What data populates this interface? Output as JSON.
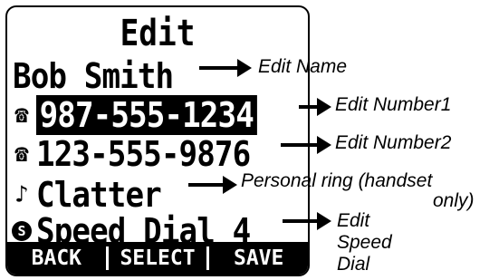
{
  "screen": {
    "title": "Edit",
    "rows": [
      {
        "icon": "",
        "text": "Bob Smith"
      },
      {
        "icon": "phone-icon",
        "glyph": "☎",
        "text": "987-555-1234"
      },
      {
        "icon": "phone-icon",
        "glyph": "☎",
        "text": "123-555-9876"
      },
      {
        "icon": "music-note-icon",
        "glyph": "♪",
        "text": "Clatter"
      },
      {
        "icon": "speed-dial-icon",
        "glyph": "S",
        "text": "Speed Dial 4"
      }
    ],
    "softkeys": [
      "BACK",
      "SELECT",
      "SAVE"
    ]
  },
  "annotations": {
    "edit_name": "Edit Name",
    "edit_number1": "Edit Number1",
    "edit_number2": "Edit Number2",
    "personal_ring_line1": "Personal ring (handset",
    "personal_ring_line2": "only)",
    "edit_speed_line1": "Edit",
    "edit_speed_line2": "Speed",
    "edit_speed_line3": "Dial"
  }
}
